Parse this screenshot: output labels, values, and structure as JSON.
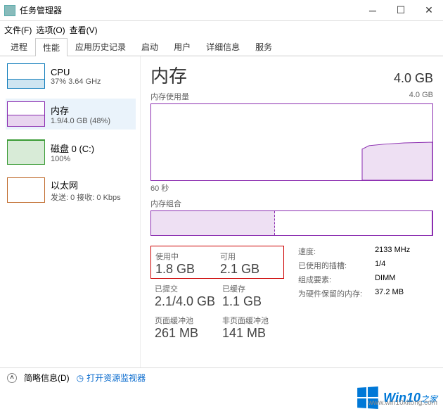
{
  "window": {
    "title": "任务管理器"
  },
  "menu": {
    "file": "文件(F)",
    "options": "选项(O)",
    "view": "查看(V)"
  },
  "tabs": {
    "processes": "进程",
    "performance": "性能",
    "app_history": "应用历史记录",
    "startup": "启动",
    "users": "用户",
    "details": "详细信息",
    "services": "服务"
  },
  "sidebar": {
    "cpu": {
      "title": "CPU",
      "sub": "37% 3.64 GHz"
    },
    "memory": {
      "title": "内存",
      "sub": "1.9/4.0 GB (48%)"
    },
    "disk": {
      "title": "磁盘 0 (C:)",
      "sub": "100%"
    },
    "ethernet": {
      "title": "以太网",
      "sub": "发送: 0 接收: 0 Kbps"
    }
  },
  "detail": {
    "name": "内存",
    "capacity": "4.0 GB",
    "usage_label": "内存使用量",
    "usage_max": "4.0 GB",
    "timescale": "60 秒",
    "composition_label": "内存组合",
    "stats": {
      "in_use": {
        "label": "使用中",
        "value": "1.8 GB"
      },
      "available": {
        "label": "可用",
        "value": "2.1 GB"
      },
      "committed": {
        "label": "已提交",
        "value": "2.1/4.0 GB"
      },
      "cached": {
        "label": "已缓存",
        "value": "1.1 GB"
      },
      "paged_pool": {
        "label": "页面缓冲池",
        "value": "261 MB"
      },
      "nonpaged_pool": {
        "label": "非页面缓冲池",
        "value": "141 MB"
      }
    },
    "right": {
      "speed": {
        "label": "速度:",
        "value": "2133 MHz"
      },
      "slots": {
        "label": "已使用的插槽:",
        "value": "1/4"
      },
      "form": {
        "label": "组成要素:",
        "value": "DIMM"
      },
      "reserved": {
        "label": "为硬件保留的内存:",
        "value": "37.2 MB"
      }
    }
  },
  "footer": {
    "fewer_details": "简略信息(D)",
    "open_resource_monitor": "打开资源监视器"
  },
  "watermark": {
    "brand": "Win10",
    "suffix": "之家",
    "url": "www.win10xitong.com"
  },
  "chart_data": {
    "type": "line",
    "title": "内存使用量",
    "xlabel": "60 秒",
    "ylabel": "",
    "ylim": [
      0,
      4.0
    ],
    "series": [
      {
        "name": "内存",
        "values": [
          0,
          0,
          0,
          0,
          0,
          0,
          0,
          0,
          0,
          0,
          0,
          0,
          0,
          0,
          0,
          0,
          0,
          0,
          0,
          0,
          0,
          0,
          0,
          0,
          0,
          0,
          0,
          0,
          0,
          0,
          0,
          0,
          0,
          0,
          0,
          0,
          0,
          0,
          0,
          0,
          0,
          0,
          0,
          0,
          0,
          1.6,
          1.7,
          1.75,
          1.8,
          1.8,
          1.8,
          1.8,
          1.82,
          1.83,
          1.84,
          1.85,
          1.86,
          1.88,
          1.9,
          1.9
        ]
      }
    ]
  }
}
